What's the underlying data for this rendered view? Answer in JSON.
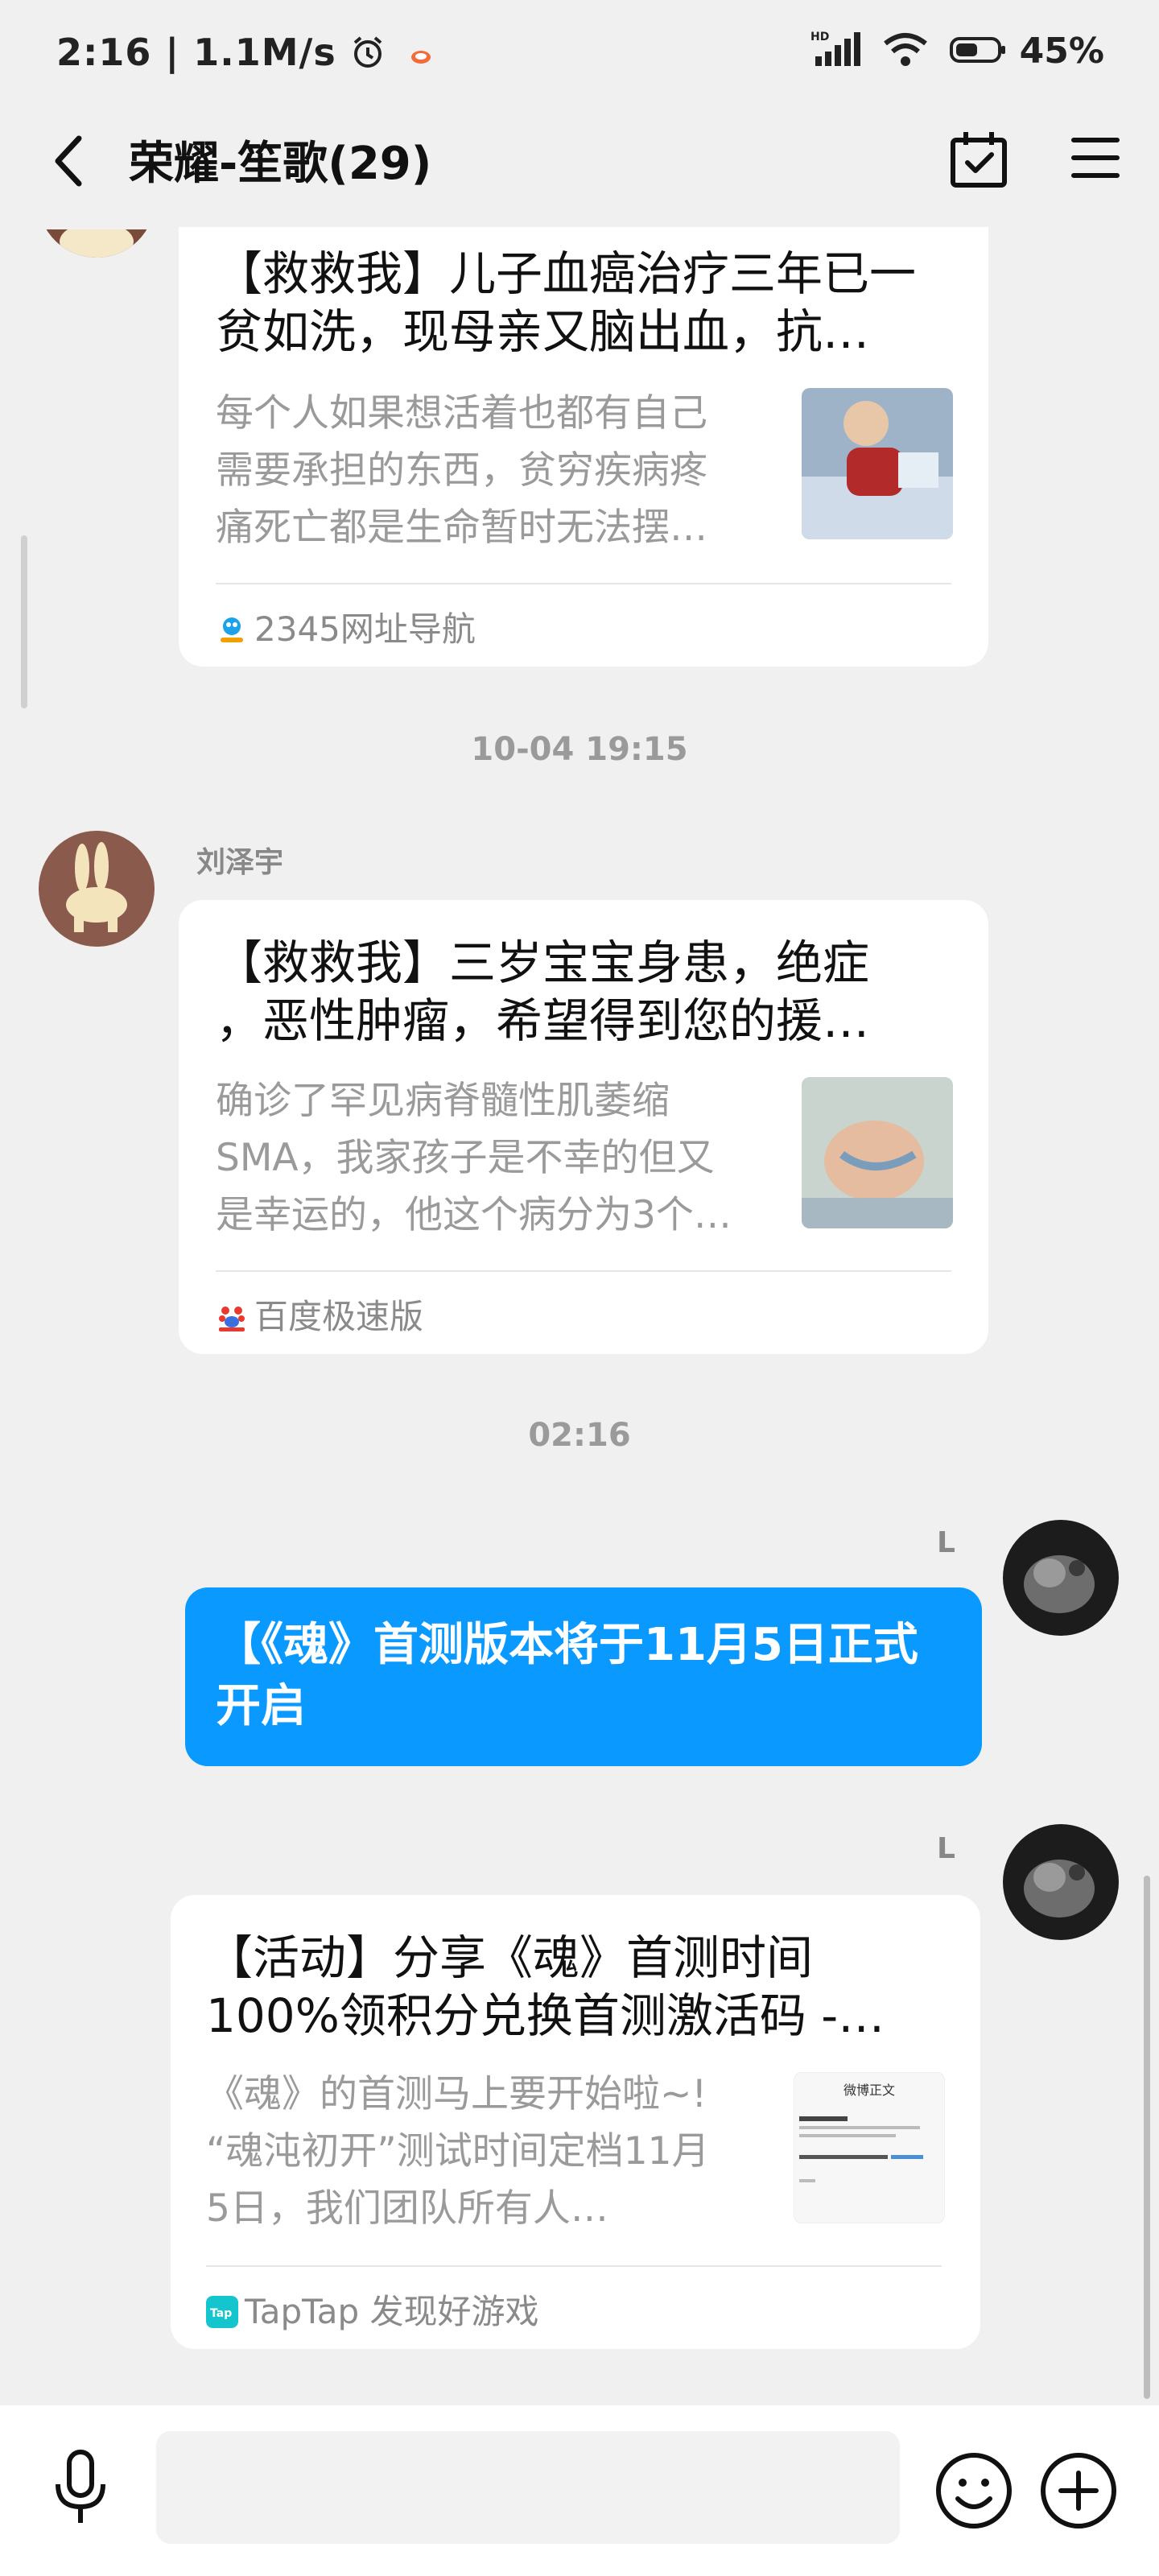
{
  "status_bar": {
    "time": "2:16",
    "network_speed": "1.1M/s",
    "battery": "45%"
  },
  "header": {
    "title": "荣耀-笙歌(29)"
  },
  "messages": [
    {
      "type": "link_card",
      "title": "【救救我】儿子血癌治疗三年已一贫如洗，现母亲又脑出血，抗…",
      "title_line1": "【救救我】儿子血癌治疗三年已一",
      "title_line2": "贫如洗，现母亲又脑出血，抗…",
      "desc_line1": "每个人如果想活着也都有自己",
      "desc_line2": "需要承担的东西，贫穷疾病疼",
      "desc_line3": "痛死亡都是生命暂时无法摆…",
      "source": "2345网址导航"
    },
    {
      "type": "timestamp",
      "text": "10-04 19:15"
    },
    {
      "type": "link_card",
      "sender": "刘泽宇",
      "title_line1": "【救救我】三岁宝宝身患，绝症",
      "title_line2": "，恶性肿瘤，希望得到您的援…",
      "desc_line1": "确诊了罕见病脊髓性肌萎缩",
      "desc_line2": "SMA，我家孩子是不幸的但又",
      "desc_line3": "是幸运的，他这个病分为3个…",
      "source": "百度极速版"
    },
    {
      "type": "timestamp",
      "text": "02:16"
    },
    {
      "type": "text_bubble",
      "sender": "L",
      "line1": "【《魂》首测版本将于11月5日正式",
      "line2": "开启"
    },
    {
      "type": "link_card",
      "sender": "L",
      "title_line1": "【活动】分享《魂》首测时间",
      "title_line2": "100%领积分兑换首测激活码 -…",
      "desc_line1": "《魂》的首测马上要开始啦~!",
      "desc_line2": "“魂沌初开”测试时间定档11月",
      "desc_line3": "5日，我们团队所有人…",
      "source": "TapTap 发现好游戏",
      "thumb_caption": "微博正文"
    }
  ],
  "colors": {
    "background": "#f0f0f0",
    "bubble_blue": "#0a99ff",
    "card": "#ffffff"
  },
  "icons": [
    "back-icon",
    "calendar-check-icon",
    "menu-icon",
    "microphone-icon",
    "emoji-icon",
    "plus-icon"
  ]
}
